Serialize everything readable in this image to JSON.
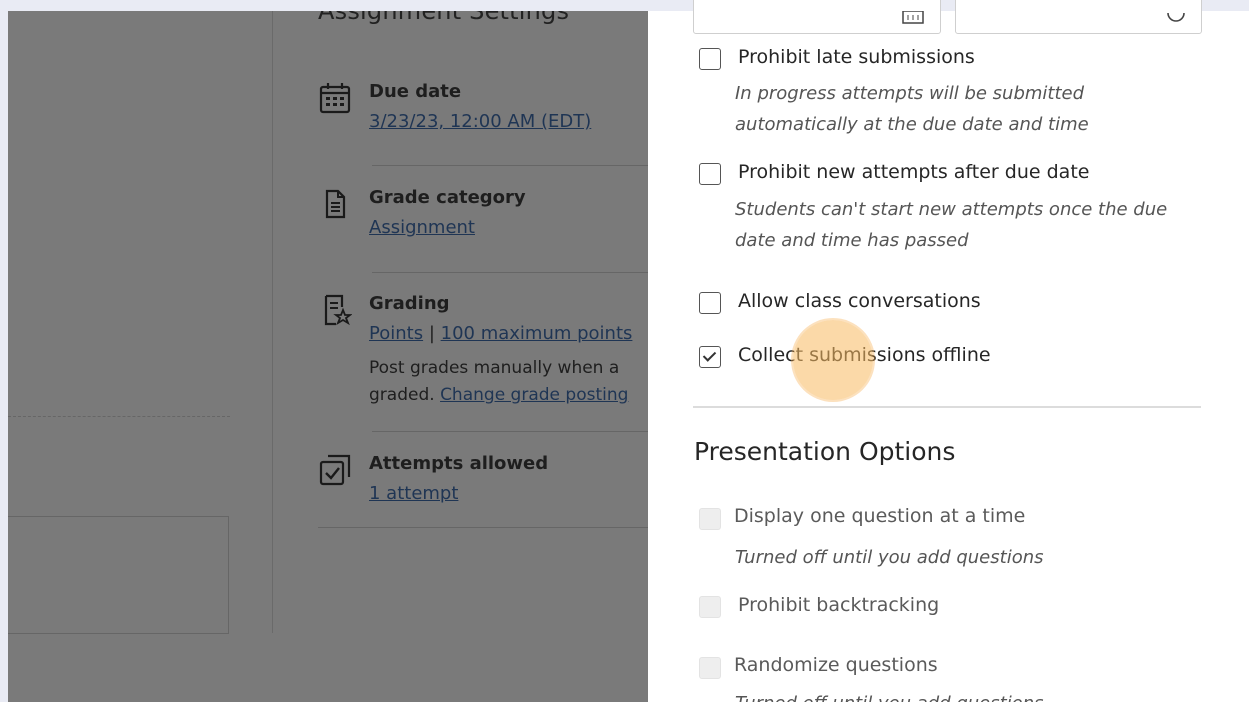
{
  "background": {
    "settings_title": "Assignment Settings",
    "settings": [
      {
        "name": "Due date",
        "link": "3/23/23, 12:00 AM (EDT)",
        "icon": "calendar-icon"
      },
      {
        "name": "Grade category",
        "link": "Assignment",
        "icon": "document-icon"
      },
      {
        "name": "Grading",
        "link1": "Points",
        "sep": "|",
        "link2": "100 maximum points",
        "line2": "Post grades manually when a",
        "line3_text": "graded.",
        "line3_link": "Change grade posting",
        "icon": "grading-star-icon"
      },
      {
        "name": "Attempts allowed",
        "link": "1 attempt",
        "icon": "attempts-checkbox-icon"
      }
    ]
  },
  "panel": {
    "options": [
      {
        "label": "Prohibit late submissions",
        "checked": false,
        "help": [
          "In progress attempts will be submitted",
          "automatically at the due date and time"
        ]
      },
      {
        "label": "Prohibit new attempts after due date",
        "checked": false,
        "help": [
          "Students can't start new attempts once the due",
          "date and time has passed"
        ]
      },
      {
        "label": "Allow class conversations",
        "checked": false
      },
      {
        "label": "Collect submissions offline",
        "checked": true
      }
    ],
    "presentation_title": "Presentation Options",
    "presentation": [
      {
        "label": "Display one question at a time",
        "disabled": true,
        "help": "Turned off until you add questions"
      },
      {
        "label": "Prohibit backtracking",
        "disabled": true
      },
      {
        "label": "Randomize questions",
        "disabled": true,
        "help": "Turned off until you add questions"
      }
    ]
  },
  "colors": {
    "overlay": "#7a7a7a",
    "panel": "#ffffff",
    "cursor_highlight": "#f8ba60"
  }
}
